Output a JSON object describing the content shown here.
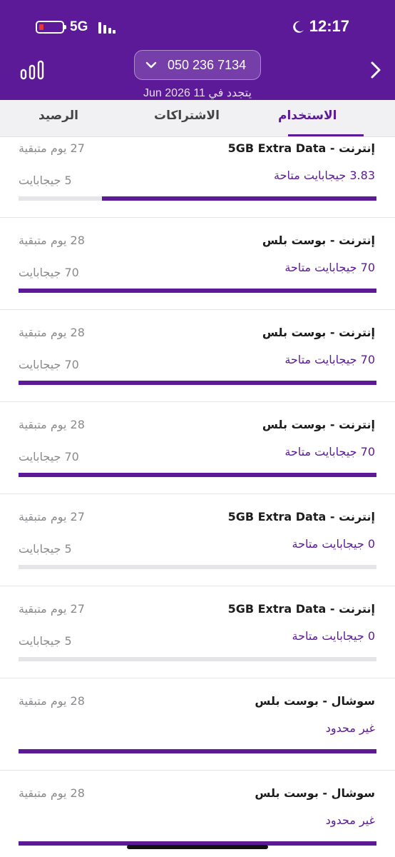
{
  "status_bar": {
    "time": "12:17",
    "network": "5G",
    "icons": [
      "moon-icon",
      "battery-icon",
      "signal-icon"
    ],
    "battery_color": "#e53935"
  },
  "header": {
    "phone_number": "050 236 7134",
    "renew_text": "يتجدد في 11 Jun 2026",
    "background": "#5c1a99",
    "icons": [
      "stats-icon",
      "chevron-down-icon",
      "forward-icon"
    ]
  },
  "tabs": [
    {
      "label": "الرصيد"
    },
    {
      "label": "الاشتراكات"
    },
    {
      "label": "الاستخدام",
      "active": true
    }
  ],
  "items": [
    {
      "title": "إنترنت - 5GB Extra Data",
      "available": "3.83 جيجابايت متاحة",
      "days": "27 يوم متبقية",
      "total": "5 جيجابايت",
      "progress": 0.766
    },
    {
      "title": "إنترنت - بوست بلس",
      "available": "70 جيجابايت متاحة",
      "days": "28 يوم متبقية",
      "total": "70 جيجابايت",
      "progress": 1
    },
    {
      "title": "إنترنت - بوست بلس",
      "available": "70 جيجابايت متاحة",
      "days": "28 يوم متبقية",
      "total": "70 جيجابايت",
      "progress": 1
    },
    {
      "title": "إنترنت - بوست بلس",
      "available": "70 جيجابايت متاحة",
      "days": "28 يوم متبقية",
      "total": "70 جيجابايت",
      "progress": 1
    },
    {
      "title": "إنترنت - 5GB Extra Data",
      "available": "0 جيجابايت متاحة",
      "days": "27 يوم متبقية",
      "total": "5 جيجابايت",
      "progress": 0
    },
    {
      "title": "إنترنت - 5GB Extra Data",
      "available": "0 جيجابايت متاحة",
      "days": "27 يوم متبقية",
      "total": "5 جيجابايت",
      "progress": 0
    },
    {
      "title": "سوشال - بوست بلس",
      "available": "غير محدود",
      "days": "28 يوم متبقية",
      "total": "",
      "progress": 1
    },
    {
      "title": "سوشال - بوست بلس",
      "available": "غير محدود",
      "days": "28 يوم متبقية",
      "total": "",
      "progress": 1
    }
  ]
}
